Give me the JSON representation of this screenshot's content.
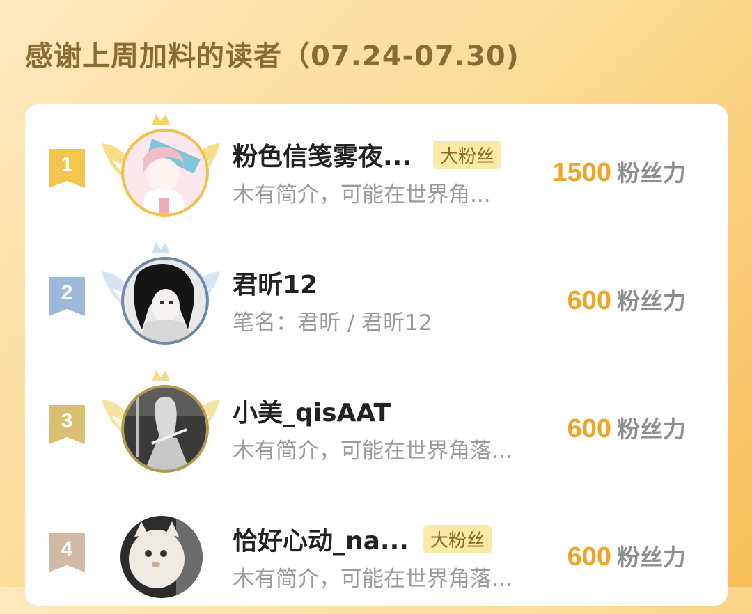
{
  "page": {
    "title": "感谢上周加料的读者（07.24-07.30)"
  },
  "colors": {
    "gold": "#f2c64c",
    "silver": "#9db8da",
    "bronze": "#d8c070",
    "fourth": "#d2b9a5",
    "accent_value": "#f0a52a"
  },
  "readers": [
    {
      "rank": "1",
      "name": "粉色信笺雾夜...",
      "tag": "大粉丝",
      "desc": "木有简介，可能在世界角...",
      "power_value": "1500",
      "power_unit": "粉丝力",
      "frame": "gold"
    },
    {
      "rank": "2",
      "name": "君昕12",
      "tag": "",
      "desc": "笔名：君昕 / 君昕12",
      "power_value": "600",
      "power_unit": "粉丝力",
      "frame": "silver"
    },
    {
      "rank": "3",
      "name": "小美_qisAAT",
      "tag": "",
      "desc": "木有简介，可能在世界角落...",
      "power_value": "600",
      "power_unit": "粉丝力",
      "frame": "bronze"
    },
    {
      "rank": "4",
      "name": "恰好心动_na...",
      "tag": "大粉丝",
      "desc": "木有简介，可能在世界角落...",
      "power_value": "600",
      "power_unit": "粉丝力",
      "frame": "none"
    }
  ]
}
